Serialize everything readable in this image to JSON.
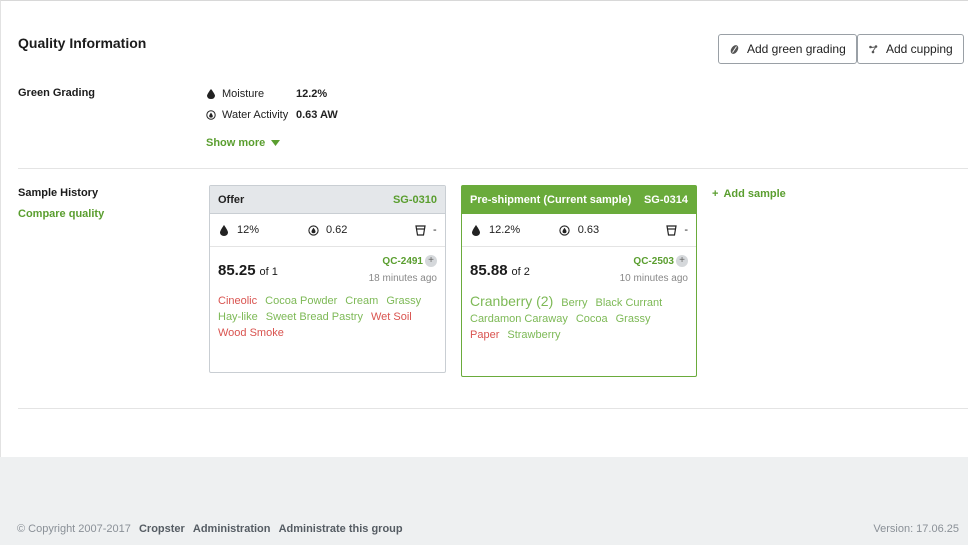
{
  "header": {
    "title": "Quality Information",
    "add_green_grading": "Add green grading",
    "add_cupping": "Add cupping"
  },
  "green_grading": {
    "label": "Green Grading",
    "rows": [
      {
        "name": "Moisture",
        "value": "12.2%",
        "icon": "drop-icon"
      },
      {
        "name": "Water Activity",
        "value": "0.63 AW",
        "icon": "water-activity-icon"
      }
    ],
    "show_more": "Show more"
  },
  "sample_history": {
    "label": "Sample History",
    "compare": "Compare quality",
    "add_sample": "Add sample",
    "cards": [
      {
        "title": "Offer",
        "code": "SG-0310",
        "moisture": "12%",
        "water_activity": "0.62",
        "density": "-",
        "score": "85.25",
        "score_of": "of 1",
        "qc": "QC-2491",
        "time": "18 minutes ago",
        "tags": [
          {
            "text": "Cineolic",
            "color": "red"
          },
          {
            "text": "Cocoa Powder",
            "color": "green"
          },
          {
            "text": "Cream",
            "color": "green"
          },
          {
            "text": "Grassy",
            "color": "green"
          },
          {
            "text": "Hay-like",
            "color": "green"
          },
          {
            "text": "Sweet Bread Pastry",
            "color": "green"
          },
          {
            "text": "Wet Soil",
            "color": "red"
          },
          {
            "text": "Wood Smoke",
            "color": "red"
          }
        ]
      },
      {
        "title": "Pre-shipment (Current sample)",
        "code": "SG-0314",
        "moisture": "12.2%",
        "water_activity": "0.63",
        "density": "-",
        "score": "85.88",
        "score_of": "of 2",
        "qc": "QC-2503",
        "time": "10 minutes ago",
        "tags": [
          {
            "text": "Cranberry (2)",
            "color": "green",
            "big": true
          },
          {
            "text": "Berry",
            "color": "green"
          },
          {
            "text": "Black Currant",
            "color": "green"
          },
          {
            "text": "Cardamon Caraway",
            "color": "green"
          },
          {
            "text": "Cocoa",
            "color": "green"
          },
          {
            "text": "Grassy",
            "color": "green"
          },
          {
            "text": "Paper",
            "color": "red"
          },
          {
            "text": "Strawberry",
            "color": "green"
          }
        ]
      }
    ]
  },
  "footer": {
    "copyright": "© Copyright 2007-2017",
    "links": [
      "Cropster",
      "Administration",
      "Administrate this group"
    ],
    "version": "Version: 17.06.25"
  },
  "colors": {
    "accent": "#6aab3b",
    "link_green": "#5a9e2f",
    "tag_red": "#d9534f"
  }
}
